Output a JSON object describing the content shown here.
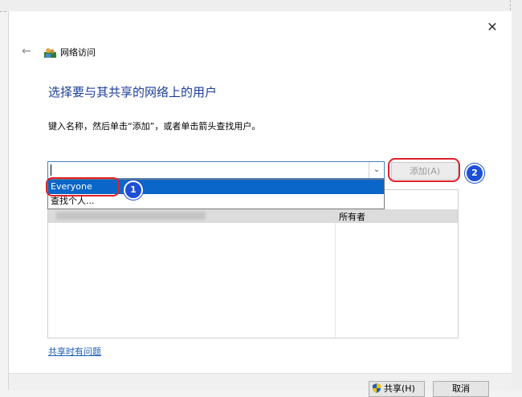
{
  "window": {
    "title": "网络访问",
    "close_glyph": "✕",
    "back_glyph": "←"
  },
  "main": {
    "heading": "选择要与其共享的网络上的用户",
    "instruction": "键入名称，然后单击“添加”，或者单击箭头查找用户。",
    "combo_arrow_glyph": "⌄",
    "add_button_label": "添加(A)",
    "dropdown": {
      "items": [
        "Everyone",
        "查找个人..."
      ],
      "selected_index": 0
    },
    "table": {
      "rows": [
        {
          "name": "",
          "permission": "所有者"
        }
      ]
    },
    "help_link": "共享时有问题"
  },
  "annotations": {
    "badge_1": "1",
    "badge_2": "2",
    "highlight_color": "#e0202a",
    "badge_color": "#1e4fd8"
  },
  "footer": {
    "share_label": "共享(H)",
    "cancel_label": "取消"
  },
  "icons": [
    "close-icon",
    "back-arrow-icon",
    "network-icon",
    "chevron-down-icon",
    "shield-icon"
  ],
  "colors": {
    "heading": "#1a3d9a",
    "selection": "#0a66c8",
    "link": "#1a5fb4"
  }
}
